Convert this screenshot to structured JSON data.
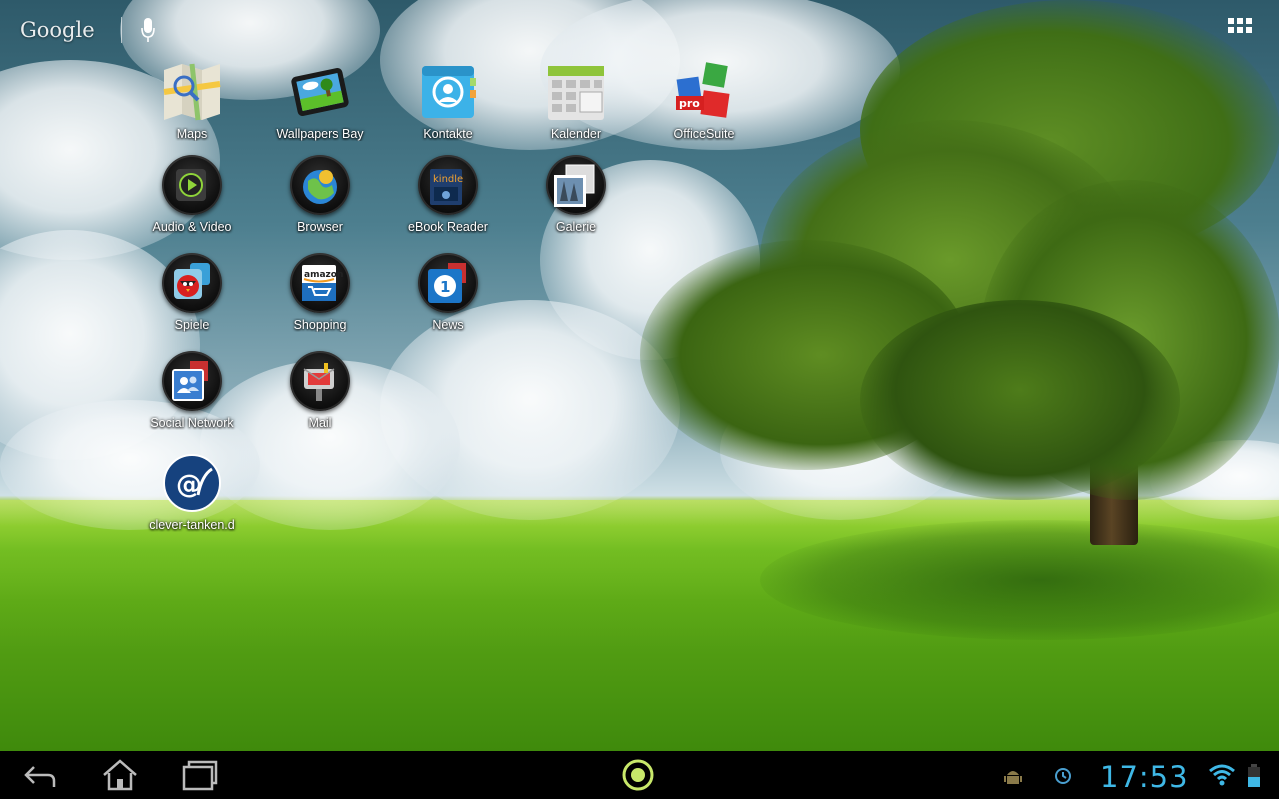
{
  "search": {
    "label": "Google"
  },
  "apps": [
    {
      "label": "Maps",
      "icon": "maps-icon"
    },
    {
      "label": "Wallpapers Bay",
      "icon": "wallpapers-icon"
    },
    {
      "label": "Kontakte",
      "icon": "contacts-icon"
    },
    {
      "label": "Kalender",
      "icon": "calendar-icon"
    },
    {
      "label": "OfficeSuite",
      "icon": "officesuite-icon"
    },
    {
      "label": "Audio & Video",
      "icon": "audio-video-folder-icon"
    },
    {
      "label": "Browser",
      "icon": "browser-folder-icon"
    },
    {
      "label": "eBook Reader",
      "icon": "ebook-reader-folder-icon"
    },
    {
      "label": "Galerie",
      "icon": "gallery-folder-icon"
    },
    {
      "label": "Spiele",
      "icon": "games-folder-icon"
    },
    {
      "label": "Shopping",
      "icon": "shopping-folder-icon"
    },
    {
      "label": "News",
      "icon": "news-folder-icon"
    },
    {
      "label": "Social Network",
      "icon": "social-network-folder-icon"
    },
    {
      "label": "Mail",
      "icon": "mail-folder-icon"
    },
    {
      "label": "clever-tanken.d",
      "icon": "clever-tanken-icon"
    }
  ],
  "status": {
    "time": "17:53"
  },
  "colors": {
    "clock": "#3fb8e6",
    "navbar": "#000000",
    "home_ring": "#c8e86a"
  }
}
